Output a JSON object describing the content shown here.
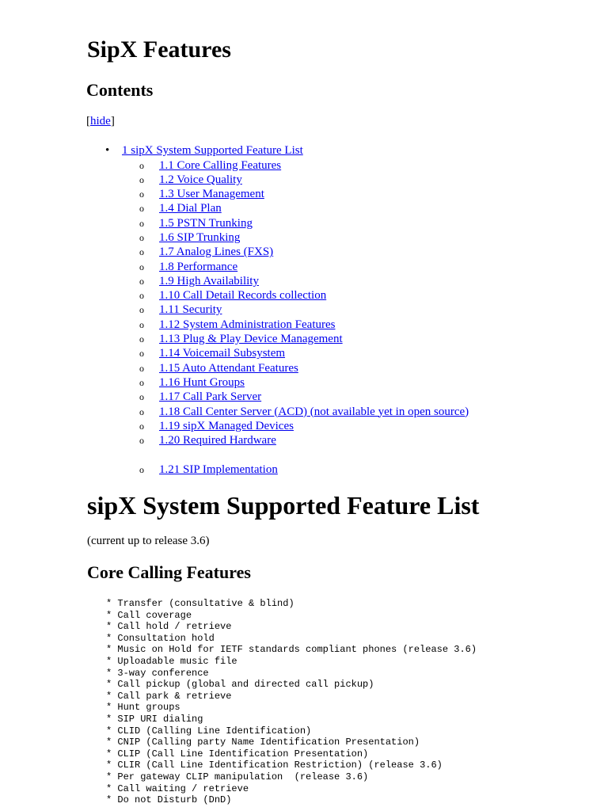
{
  "title": "SipX Features",
  "contents_heading": "Contents",
  "hide": {
    "open": "[",
    "label": "hide",
    "close": "]"
  },
  "toc": {
    "top": "1 sipX System Supported Feature List",
    "items": [
      "1.1 Core Calling Features",
      "1.2 Voice Quality",
      "1.3 User Management",
      "1.4 Dial Plan",
      "1.5 PSTN Trunking",
      "1.6 SIP Trunking",
      "1.7 Analog Lines (FXS)",
      "1.8 Performance",
      "1.9 High Availability",
      "1.10 Call Detail Records collection",
      "1.11 Security",
      "1.12 System Administration Features",
      "1.13 Plug & Play Device Management",
      "1.14 Voicemail Subsystem",
      "1.15 Auto Attendant Features",
      "1.16 Hunt Groups",
      "1.17 Call Park Server",
      "1.18 Call Center Server (ACD) (not available yet in open source)",
      "1.19 sipX Managed Devices",
      "1.20 Required Hardware"
    ],
    "last": "1.21 SIP Implementation"
  },
  "section_heading": "sipX System Supported Feature List",
  "current": "(current up to release 3.6)",
  "core_heading": "Core Calling Features",
  "core_features": [
    "* Transfer (consultative & blind)",
    "* Call coverage",
    "* Call hold / retrieve",
    "* Consultation hold",
    "* Music on Hold for IETF standards compliant phones (release 3.6)",
    "* Uploadable music file",
    "* 3-way conference",
    "* Call pickup (global and directed call pickup)",
    "* Call park & retrieve",
    "* Hunt groups",
    "* SIP URI dialing",
    "* CLID (Calling Line Identification)",
    "* CNIP (Calling party Name Identification Presentation)",
    "* CLIP (Call Line Identification Presentation)",
    "* CLIR (Call Line Identification Restriction) (release 3.6)",
    "* Per gateway CLIP manipulation  (release 3.6)",
    "* Call waiting / retrieve",
    "* Do not Disturb (DnD)"
  ]
}
